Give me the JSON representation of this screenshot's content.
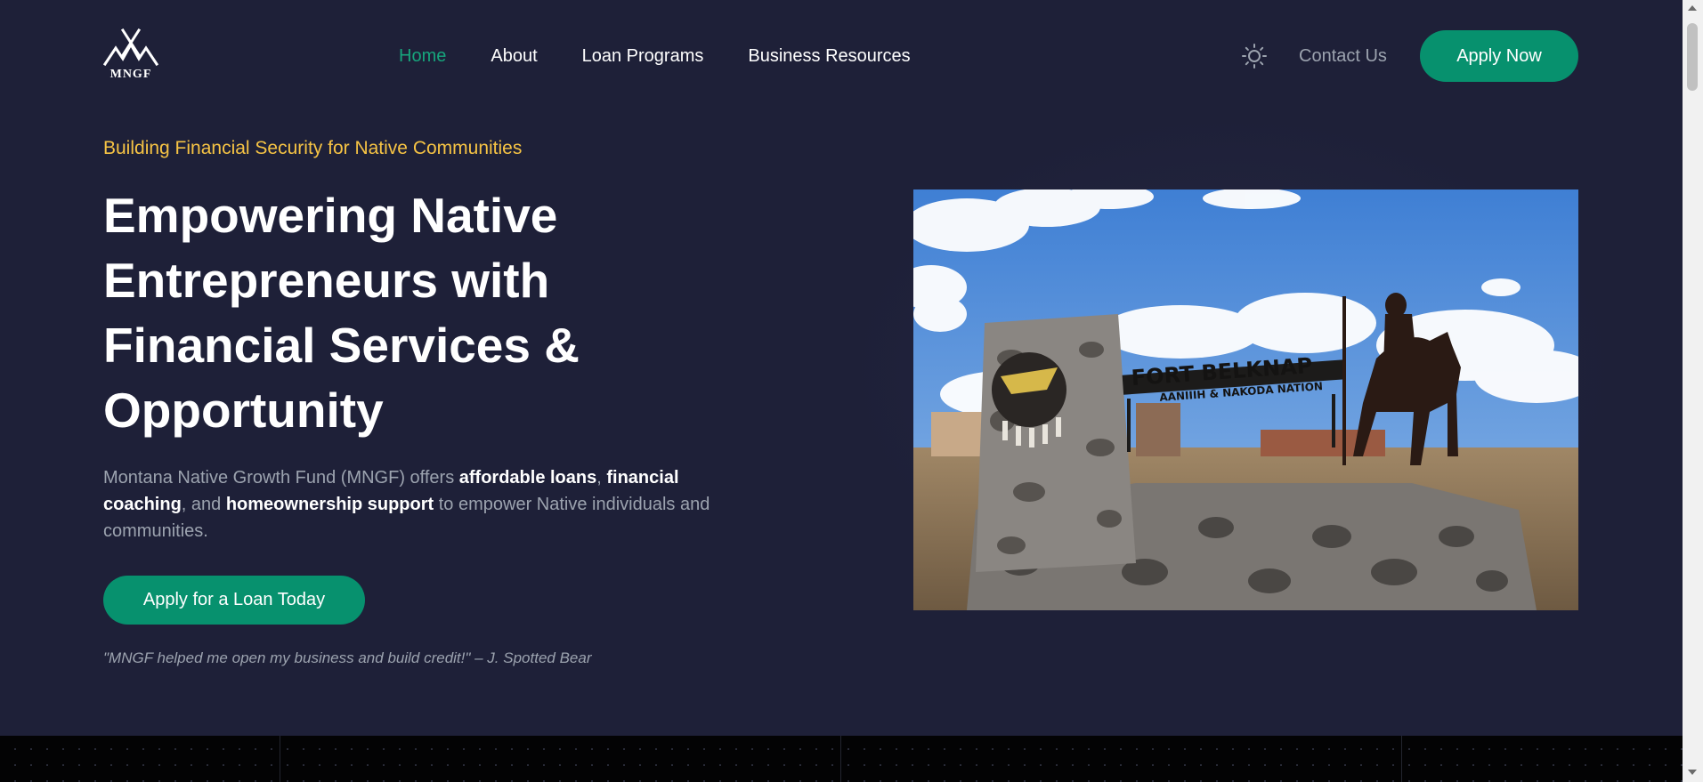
{
  "brand": {
    "logo_text": "MNGF"
  },
  "nav": {
    "links": [
      {
        "label": "Home",
        "active": true
      },
      {
        "label": "About",
        "active": false
      },
      {
        "label": "Loan Programs",
        "active": false
      },
      {
        "label": "Business Resources",
        "active": false
      }
    ],
    "theme_toggle_icon": "sun-icon",
    "contact_label": "Contact Us",
    "apply_label": "Apply Now"
  },
  "hero": {
    "tagline": "Building Financial Security for Native Communities",
    "title": "Empowering Native Entrepreneurs with Financial Services & Opportunity",
    "description": {
      "p1": "Montana Native Growth Fund (MNGF) offers ",
      "b1": "affordable loans",
      "p2": ", ",
      "b2": "financial coaching",
      "p3": ", and ",
      "b3": "homeownership support",
      "p4": " to empower Native individuals and communities."
    },
    "cta_label": "Apply for a Loan Today",
    "quote": "\"MNGF helped me open my business and build credit!\" – J. Spotted Bear"
  },
  "image": {
    "sign_line1": "FORT BELKNAP",
    "sign_line2": "AANIIIH & NAKODA NATION"
  },
  "colors": {
    "background": "#1e2038",
    "accent": "#07916e",
    "active_link": "#17a57c",
    "tagline": "#f6c344",
    "muted": "#9ca3af"
  }
}
